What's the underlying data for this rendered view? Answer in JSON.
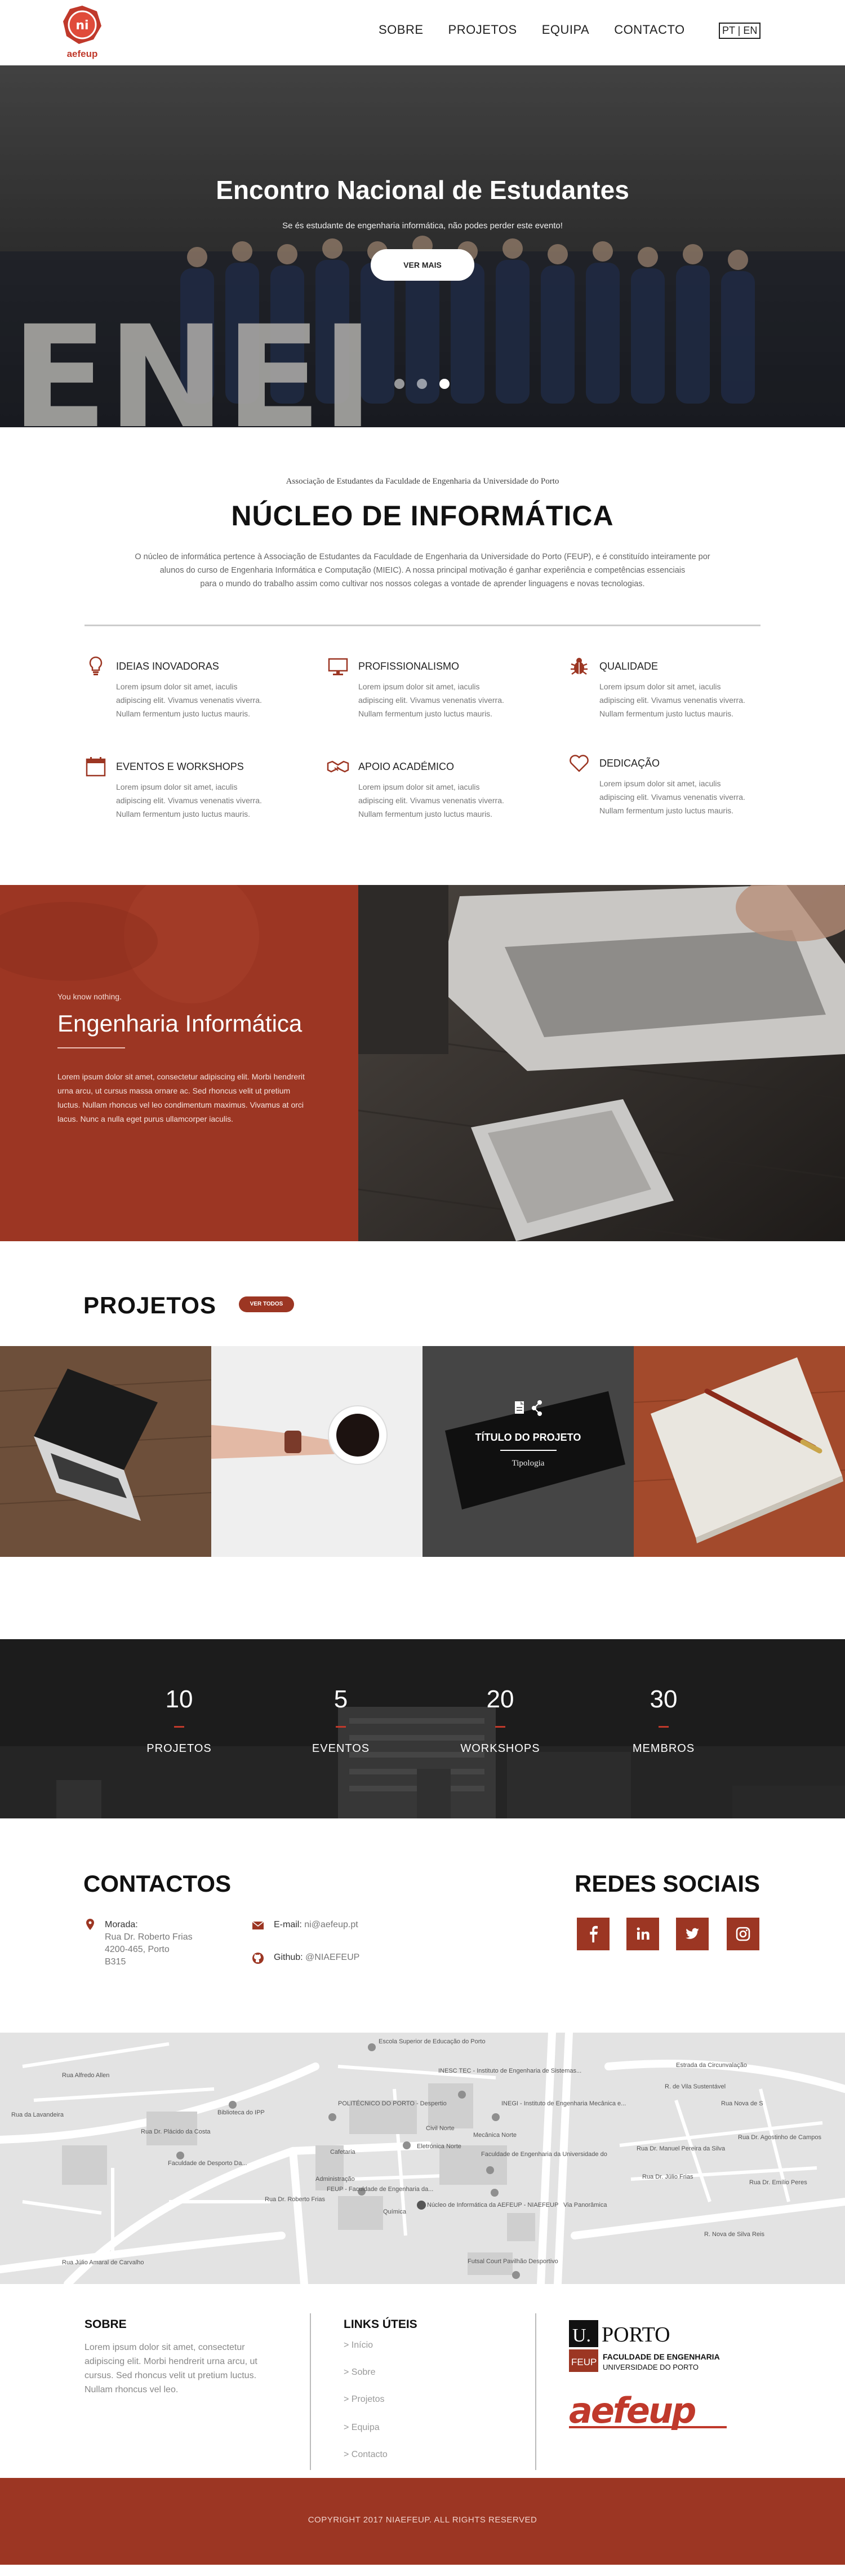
{
  "brand": {
    "logo_badge": "ni",
    "logo_text": "aefeup",
    "accent": "#9c3623"
  },
  "nav": {
    "items": [
      "SOBRE",
      "PROJETOS",
      "EQUIPA",
      "CONTACTO"
    ],
    "lang": "PT | EN"
  },
  "hero": {
    "title": "Encontro Nacional de Estudantes",
    "subtitle": "Se és estudante de engenharia informática, não podes perder este evento!",
    "button": "VER MAIS",
    "backdrop_letters": "ENEI",
    "slides_total": 3,
    "slide_active": 3
  },
  "about": {
    "kicker": "Associação de Estudantes da Faculdade de Engenharia da Universidade do Porto",
    "title": "NÚCLEO DE INFORMÁTICA",
    "desc_lines": [
      "O núcleo de informática pertence à Associação de Estudantes da Faculdade de Engenharia da Universidade do Porto (FEUP), e é constituído inteiramente por",
      "alunos do curso de Engenharia Informática e Computação (MIEIC). A nossa principal motivação é ganhar experiência e competências essenciais",
      "para o mundo do trabalho assim como cultivar nos nossos colegas a vontade de aprender linguagens e novas tecnologias."
    ],
    "features": [
      {
        "icon": "lightbulb-icon",
        "title": "IDEIAS INOVADORAS",
        "lines": [
          "Lorem ipsum dolor sit amet, iaculis",
          "adipiscing elit. Vivamus venenatis viverra.",
          "Nullam fermentum justo luctus mauris."
        ]
      },
      {
        "icon": "monitor-icon",
        "title": "PROFISSIONALISMO",
        "lines": [
          "Lorem ipsum dolor sit amet, iaculis",
          "adipiscing elit. Vivamus venenatis viverra.",
          "Nullam fermentum justo luctus mauris."
        ]
      },
      {
        "icon": "bug-icon",
        "title": "QUALIDADE",
        "lines": [
          "Lorem ipsum dolor sit amet, iaculis",
          "adipiscing elit. Vivamus venenatis viverra.",
          "Nullam fermentum justo luctus mauris."
        ]
      },
      {
        "icon": "calendar-icon",
        "title": "EVENTOS E WORKSHOPS",
        "lines": [
          "Lorem ipsum dolor sit amet, iaculis",
          "adipiscing elit. Vivamus venenatis viverra.",
          "Nullam fermentum justo luctus mauris."
        ]
      },
      {
        "icon": "handshake-icon",
        "title": "APOIO ACADÉMICO",
        "lines": [
          "Lorem ipsum dolor sit amet, iaculis",
          "adipiscing elit. Vivamus venenatis viverra.",
          "Nullam fermentum justo luctus mauris."
        ]
      },
      {
        "icon": "heart-icon",
        "title": "DEDICAÇÃO",
        "lines": [
          "Lorem ipsum dolor sit amet, iaculis",
          "adipiscing elit. Vivamus venenatis viverra.",
          "Nullam fermentum justo luctus mauris."
        ]
      }
    ]
  },
  "band": {
    "kicker": "You know nothing.",
    "title": "Engenharia Informática",
    "text_lines": [
      "Lorem ipsum dolor sit amet, consectetur adipiscing elit. Morbi hendrerit",
      "urna arcu, ut cursus massa ornare ac. Sed rhoncus velit ut pretium",
      "luctus. Nullam rhoncus vel leo condimentum maximus. Vivamus at orci",
      "lacus. Nunc a nulla eget purus ullamcorper iaculis."
    ]
  },
  "projects": {
    "title": "PROJETOS",
    "button": "VER TODOS",
    "tile_title": "TÍTULO DO PROJETO",
    "tile_sub": "Tipologia"
  },
  "stats": [
    {
      "value": "10",
      "label": "PROJETOS"
    },
    {
      "value": "5",
      "label": "EVENTOS"
    },
    {
      "value": "20",
      "label": "WORKSHOPS"
    },
    {
      "value": "30",
      "label": "MEMBROS"
    }
  ],
  "contacts": {
    "title": "CONTACTOS",
    "address_label": "Morada:",
    "address_lines": [
      "Rua Dr. Roberto Frias",
      "4200-465, Porto",
      "B315"
    ],
    "email_label": "E-mail:",
    "email": "ni@aefeup.pt",
    "github_label": "Github:",
    "github": "@NIAEFEUP",
    "social_title": "REDES SOCIAIS",
    "social": [
      "facebook-icon",
      "linkedin-icon",
      "twitter-icon",
      "instagram-icon"
    ]
  },
  "map": {
    "labels": [
      "Escola Superior de Educação do Porto",
      "INESC TEC - Instituto de Engenharia de Sistemas...",
      "INEGI - Instituto de Engenharia Mecânica e...",
      "POLITÉCNICO DO PORTO - Despertio",
      "Biblioteca do IPP",
      "Eletrónica Norte",
      "Faculdade de Engenharia da Universidade do",
      "Faculdade de Desporto Da...",
      "FEUP - Faculdade de Engenharia da...",
      "Núcleo de Informática da AEFEUP - NIAEFEUP",
      "Futsal Court Pavilhão Desportivo",
      "Estrada da Circunvalação",
      "Rua Dr. Roberto Frias",
      "Rua Dr. Plácido da Costa",
      "Rua Júlio Amaral de Carvalho",
      "Rua Alfredo Allen",
      "Via Panorâmica",
      "R. Nova de Silva Reis",
      "Civil Norte",
      "Cafetaria",
      "Administração",
      "Mecânica Norte",
      "Química",
      "Rua Nova de S",
      "Rua Dr. Manuel Pereira da Silva",
      "Rua Dr. Júlio Frias",
      "Rua Dr. Emílio Peres",
      "Rua Dr. Agostinho de Campos",
      "Rua da Lavandeira",
      "R. de Vila Sustentável"
    ]
  },
  "footer": {
    "about_title": "SOBRE",
    "about_lines": [
      "Lorem ipsum dolor sit amet, consectetur",
      "adipiscing elit. Morbi hendrerit urna arcu, ut",
      "cursus. Sed rhoncus velit ut pretium luctus.",
      "Nullam rhoncus vel leo."
    ],
    "links_title": "LINKS ÚTEIS",
    "links": [
      "> Início",
      "> Sobre",
      "> Projetos",
      "> Equipa",
      "> Contacto"
    ],
    "logo_up_mark": "U.",
    "logo_up_name": "PORTO",
    "logo_feup_mark": "FEUP",
    "logo_feup_line1": "FACULDADE DE ENGENHARIA",
    "logo_feup_line2": "UNIVERSIDADE DO PORTO",
    "logo_aefeup": "aefeup"
  },
  "copyright": "COPYRIGHT 2017 NIAEFEUP. ALL RIGHTS RESERVED"
}
